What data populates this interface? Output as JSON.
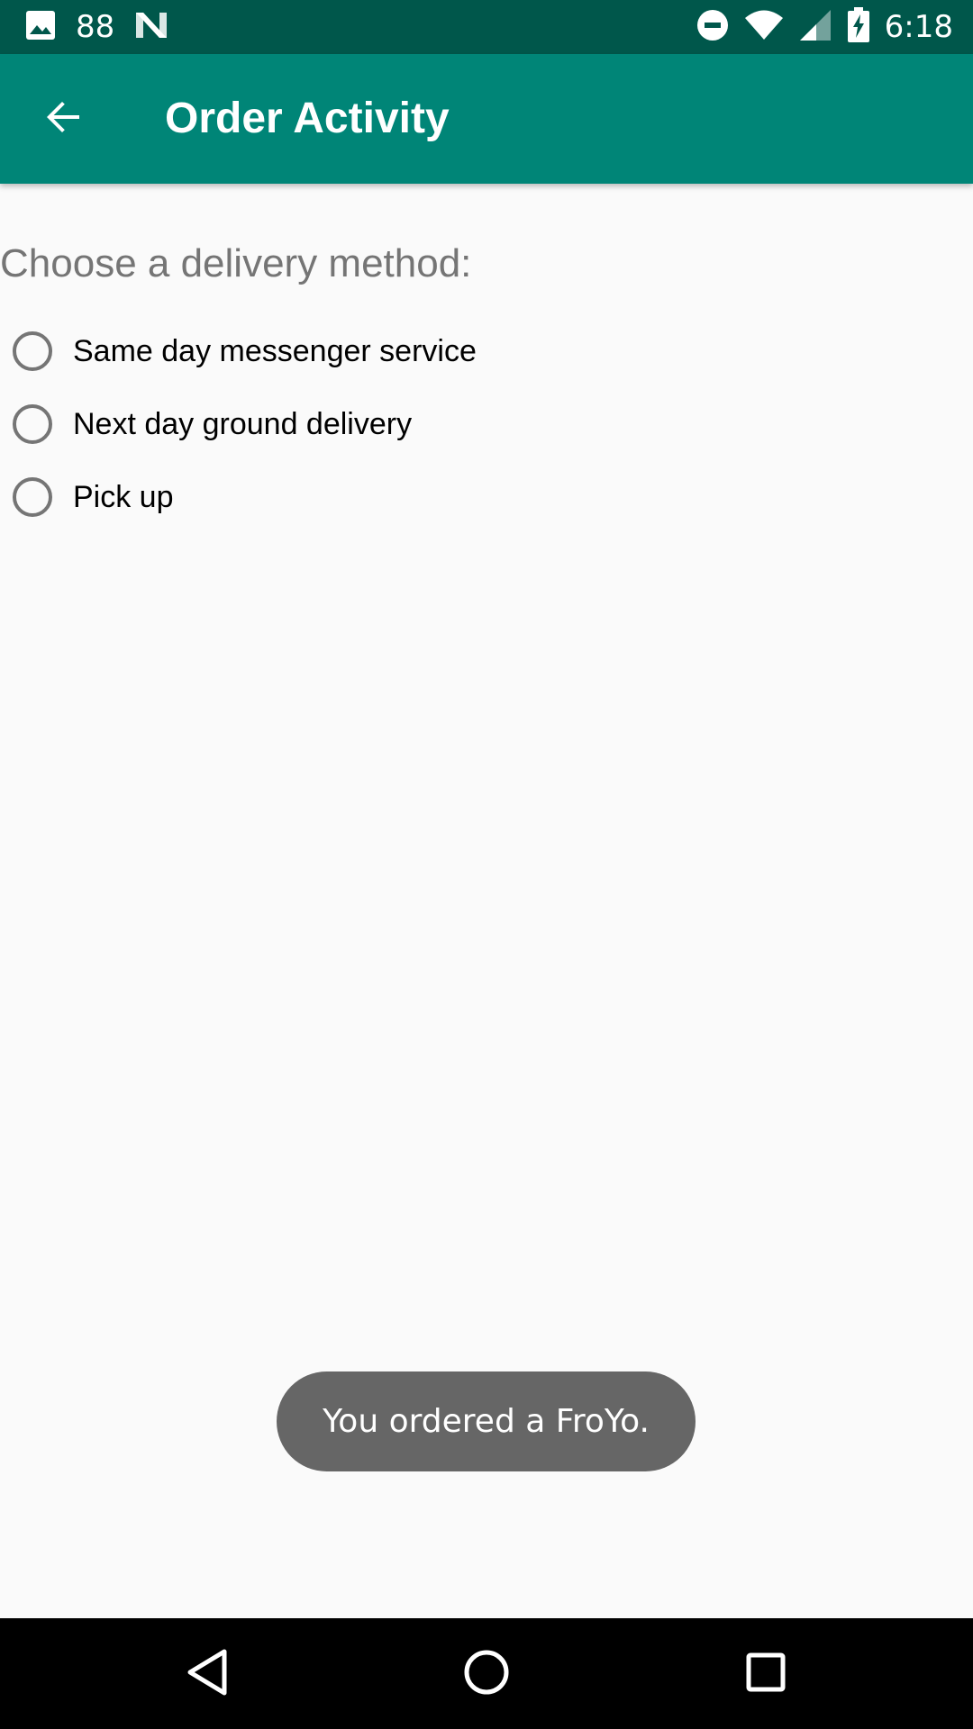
{
  "status_bar": {
    "notification_count": "88",
    "time": "6:18",
    "icons": [
      "image-icon",
      "n-icon",
      "do-not-disturb-icon",
      "wifi-icon",
      "cell-signal-icon",
      "battery-charging-icon"
    ]
  },
  "app_bar": {
    "title": "Order Activity",
    "back_icon": "arrow-back-icon",
    "color": "#008577"
  },
  "content": {
    "heading": "Choose a delivery method:",
    "options": [
      {
        "label": "Same day messenger service",
        "checked": false
      },
      {
        "label": "Next day ground delivery",
        "checked": false
      },
      {
        "label": "Pick up",
        "checked": false
      }
    ]
  },
  "toast": {
    "message": "You ordered a FroYo."
  },
  "nav_bar": {
    "icons": [
      "back-triangle-icon",
      "home-circle-icon",
      "recents-square-icon"
    ]
  },
  "colors": {
    "status_bar": "#00574B",
    "app_bar": "#008577",
    "background": "#FAFAFA",
    "toast": "#666666"
  }
}
